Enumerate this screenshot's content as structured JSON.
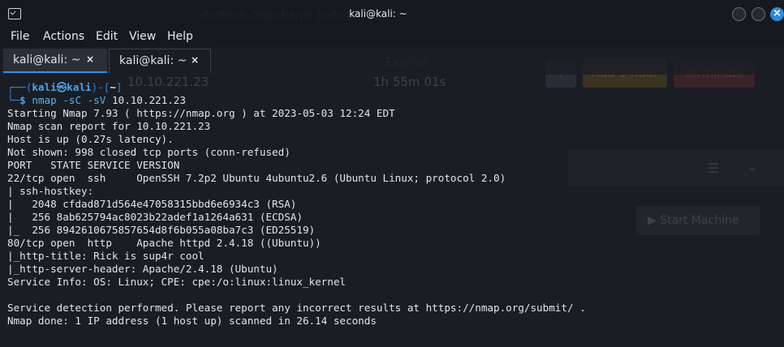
{
  "background_app": {
    "title": "Active Machine Informati",
    "expires_label": "Expires",
    "ip": "10.10.221.23",
    "expires_value": "1h 55m 01s",
    "help_button": "?",
    "add_hour_button": "Add 1 hour",
    "terminate_button": "Terminate",
    "start_machine_button": "Start Machine"
  },
  "window": {
    "title": "kali@kali: ~",
    "app_icon": "terminal-icon",
    "close_glyph": "×"
  },
  "menu": [
    "File",
    "Actions",
    "Edit",
    "View",
    "Help"
  ],
  "tabs": [
    {
      "label": "kali@kali: ~",
      "close": "×",
      "active": true
    },
    {
      "label": "kali@kali: ~",
      "close": "×",
      "active": false
    }
  ],
  "prompt": {
    "line1_prefix": "┌──(",
    "user": "kali",
    "at": "㉿",
    "host": "kali",
    "line1_mid": ")-[",
    "path": "~",
    "line1_suffix": "]",
    "line2_prefix": "└─",
    "dollar": "$",
    "command": "nmap",
    "args": "-sC -sV",
    "target": "10.10.221.23"
  },
  "output": [
    "Starting Nmap 7.93 ( https://nmap.org ) at 2023-05-03 12:24 EDT",
    "Nmap scan report for 10.10.221.23",
    "Host is up (0.27s latency).",
    "Not shown: 998 closed tcp ports (conn-refused)",
    "PORT   STATE SERVICE VERSION",
    "22/tcp open  ssh     OpenSSH 7.2p2 Ubuntu 4ubuntu2.6 (Ubuntu Linux; protocol 2.0)",
    "| ssh-hostkey: ",
    "|   2048 cfdad871d564e47058315bbd6e6934c3 (RSA)",
    "|   256 8ab625794ac8023b22adef1a1264a631 (ECDSA)",
    "|_  256 8942610675857654d8f6b055a08ba7c3 (ED25519)",
    "80/tcp open  http    Apache httpd 2.4.18 ((Ubuntu))",
    "|_http-title: Rick is sup4r cool",
    "|_http-server-header: Apache/2.4.18 (Ubuntu)",
    "Service Info: OS: Linux; CPE: cpe:/o:linux:linux_kernel",
    "",
    "Service detection performed. Please report any incorrect results at https://nmap.org/submit/ .",
    "Nmap done: 1 IP address (1 host up) scanned in 26.14 seconds"
  ],
  "colors": {
    "terminal_bg": "#1b1d24",
    "prompt_blue": "#2d87d2",
    "accent_blue": "#3592dc"
  }
}
